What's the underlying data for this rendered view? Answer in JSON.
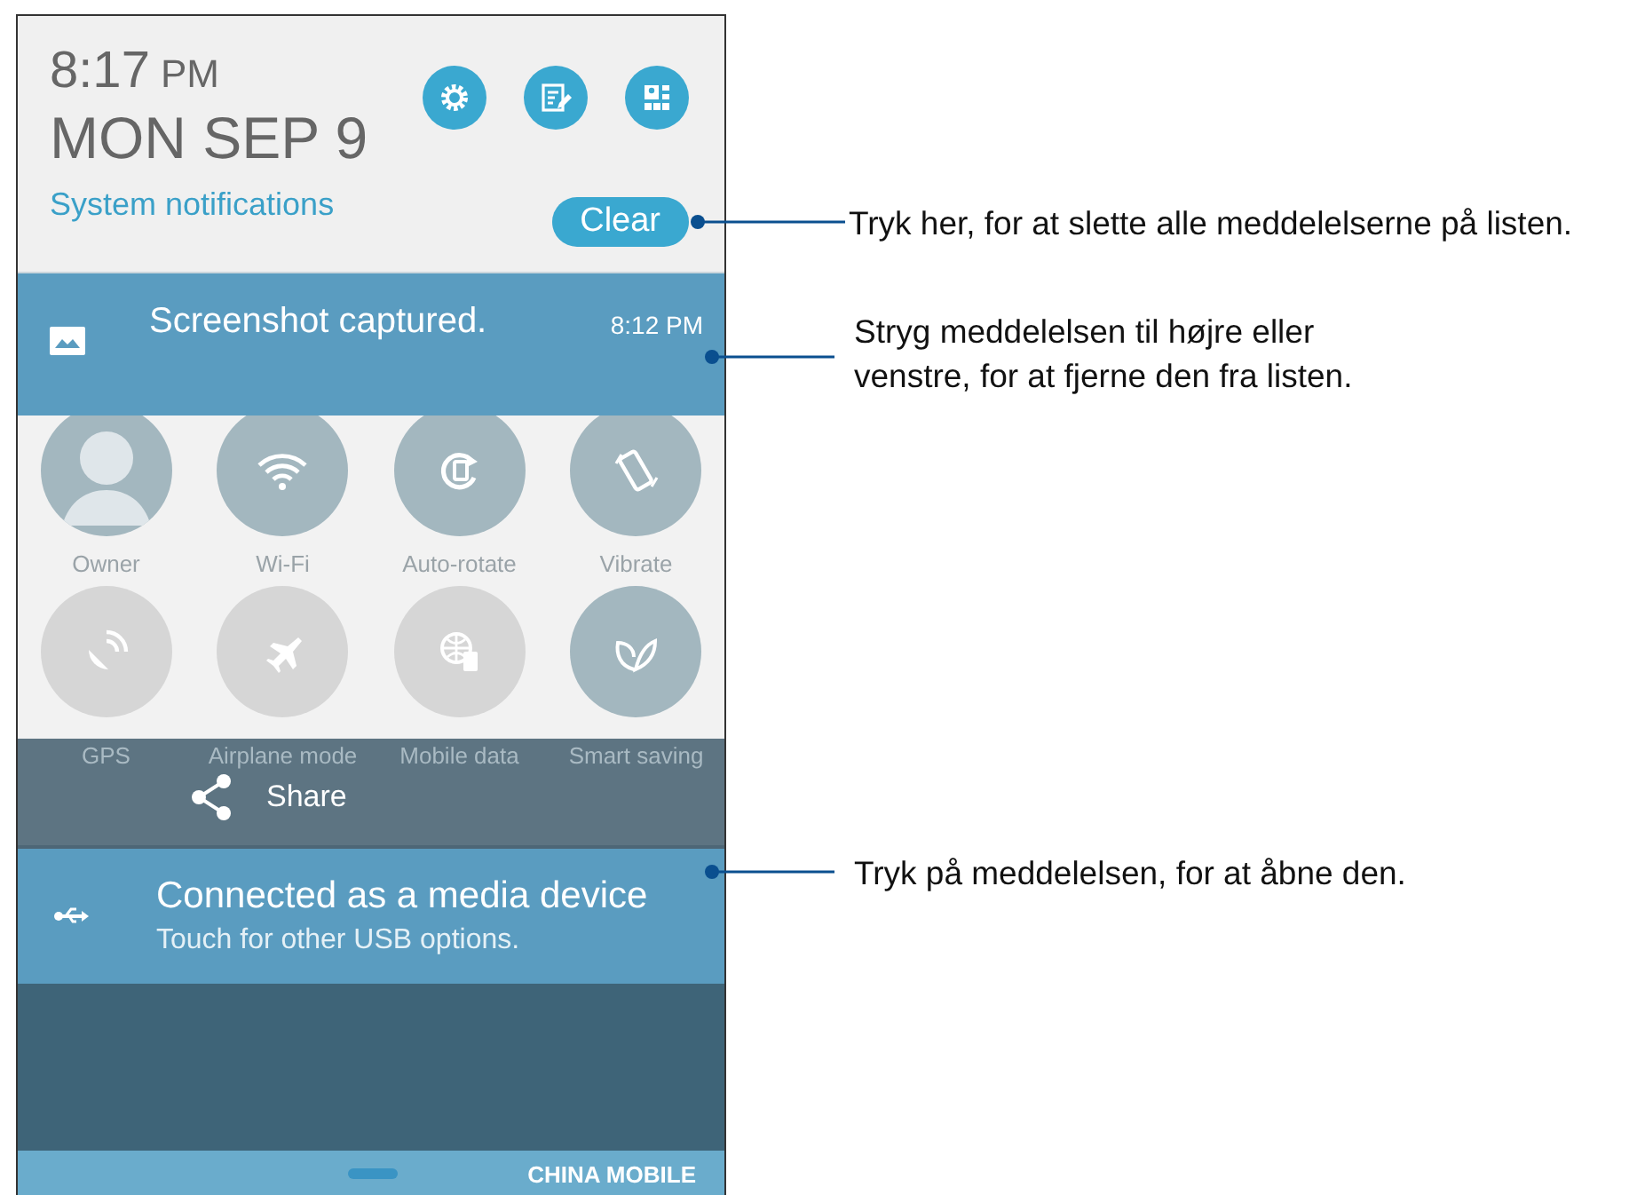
{
  "header": {
    "time": "8:17",
    "time_suffix": "PM",
    "date": "MON SEP 9",
    "section_label": "System notifications",
    "clear_button": "Clear",
    "actions": [
      {
        "kind": "settings"
      },
      {
        "kind": "edit"
      },
      {
        "kind": "layout"
      }
    ]
  },
  "screenshot_notification": {
    "title": "Screenshot captured.",
    "time": "8:12 PM"
  },
  "quick_settings": [
    {
      "kind": "owner",
      "label": "Owner",
      "on": true
    },
    {
      "kind": "wifi",
      "label": "Wi-Fi",
      "on": true
    },
    {
      "kind": "rotate",
      "label": "Auto-rotate",
      "on": true
    },
    {
      "kind": "vibrate",
      "label": "Vibrate",
      "on": true
    },
    {
      "kind": "gps",
      "label": "GPS",
      "on": false
    },
    {
      "kind": "airplane",
      "label": "Airplane mode",
      "on": false
    },
    {
      "kind": "data",
      "label": "Mobile data",
      "on": false
    },
    {
      "kind": "leaf",
      "label": "Smart saving",
      "on": true
    }
  ],
  "share_overlay": {
    "label": "Share"
  },
  "usb_notification": {
    "title": "Connected as a media device",
    "subtitle": "Touch for other USB options."
  },
  "bottom_bar": {
    "carrier": "CHINA MOBILE"
  },
  "callouts": [
    {
      "text": "Tryk her, for at slette alle meddelelserne på listen."
    },
    {
      "text": "Stryg meddelelsen til højre eller venstre, for at fjerne den fra listen."
    },
    {
      "text": "Tryk på meddelelsen, for at åbne den."
    }
  ]
}
